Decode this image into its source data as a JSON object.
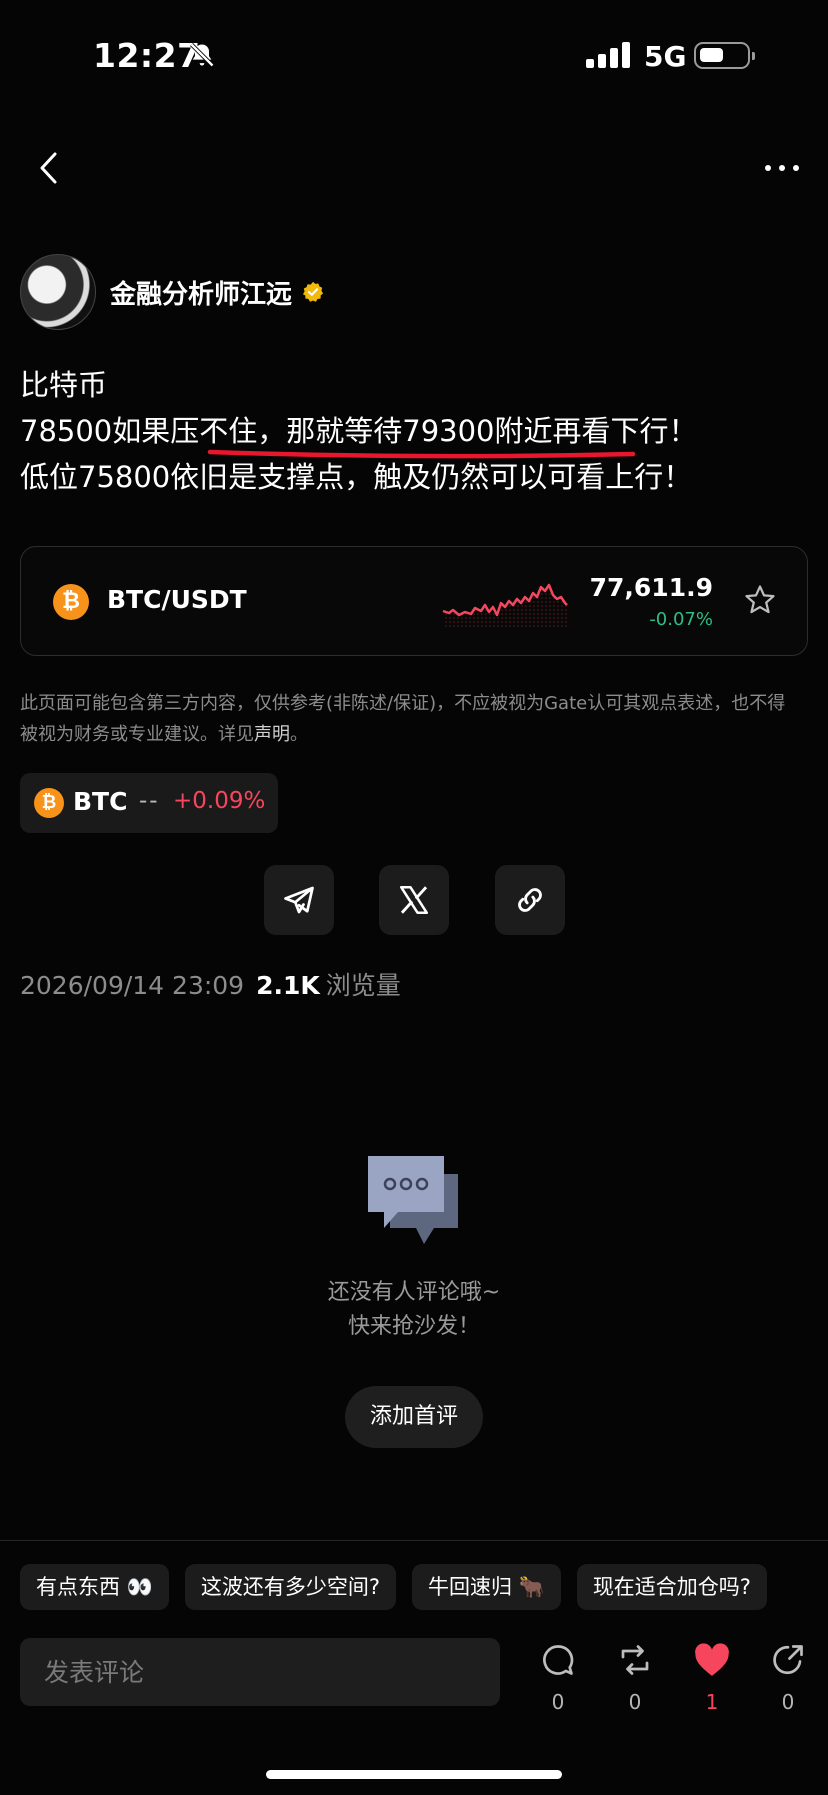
{
  "status_bar": {
    "time": "12:27",
    "network": "5G"
  },
  "author": {
    "name": "金融分析师江远"
  },
  "post": {
    "lines": [
      "比特币",
      "78500如果压不住，那就等待79300附近再看下行！",
      "低位75800依旧是支撑点，触及仍然可以可看上行！"
    ]
  },
  "ticker_card": {
    "icon": "bitcoin-icon",
    "pair": "BTC/USDT",
    "price": "77,611.9",
    "change": "-0.07%",
    "change_color": "#2ebd85",
    "sparkline_color": "#f6465d"
  },
  "disclaimer": {
    "text": "此页面可能包含第三方内容，仅供参考(非陈述/保证)，不应被视为Gate认可其观点表述，也不得被视为财务或专业建议。详见",
    "link": "声明",
    "end": "。"
  },
  "btc_chip": {
    "symbol": "BTC",
    "dash": "--",
    "change": "+0.09%"
  },
  "share": [
    "telegram-icon",
    "x-icon",
    "link-icon"
  ],
  "meta": {
    "date": "2026/09/14 23:09",
    "views": "2.1K",
    "views_label": "浏览量"
  },
  "empty_state": {
    "line1": "还没有人评论哦~",
    "line2": "快来抢沙发！",
    "button": "添加首评"
  },
  "quick_replies": [
    "有点东西 👀",
    "这波还有多少空间?",
    "牛回速归 🐂",
    "现在适合加仓吗?"
  ],
  "bottom_bar": {
    "placeholder": "发表评论",
    "comments": "0",
    "reposts": "0",
    "likes": "1",
    "shares": "0"
  },
  "colors": {
    "up": "#2ebd85",
    "down": "#f6465d",
    "bitcoin": "#f7931a",
    "verified": "#f0b90b"
  }
}
